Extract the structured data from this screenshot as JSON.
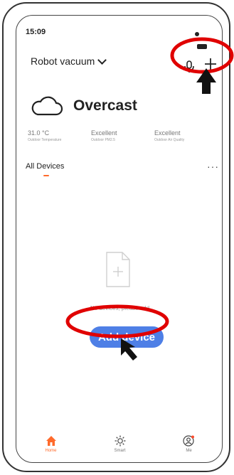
{
  "status_bar": {
    "time": "15:09"
  },
  "header": {
    "home_name": "Robot vacuum"
  },
  "weather": {
    "condition": "Overcast"
  },
  "stats": [
    {
      "value": "31.0 °C",
      "label": "Outdoor Temperature"
    },
    {
      "value": "Excellent",
      "label": "Outdoor PM2.5"
    },
    {
      "value": "Excellent",
      "label": "Outdoor Air Quality"
    }
  ],
  "tabs": {
    "all_devices": "All Devices",
    "more": "···"
  },
  "empty_state": {
    "message": "No devices, please add",
    "add_button": "Add device"
  },
  "tabbar": [
    {
      "label": "Home",
      "active": true,
      "icon": "home-icon"
    },
    {
      "label": "Smart",
      "active": false,
      "icon": "sun-icon"
    },
    {
      "label": "Me",
      "active": false,
      "icon": "profile-icon"
    }
  ],
  "colors": {
    "accent": "#ff6a2b",
    "button": "#4e7fe6",
    "annotation_circle": "#e00000",
    "annotation_arrow": "#111111"
  }
}
